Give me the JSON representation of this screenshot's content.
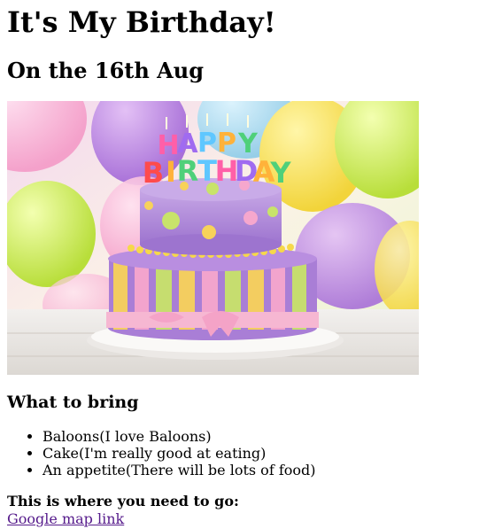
{
  "page": {
    "title": "It's My Birthday!",
    "subtitle": "On the 16th Aug",
    "image": {
      "alt": "Happy Birthday cake with balloons",
      "candle_text": "HAPPY BIRTHDAY"
    },
    "bring": {
      "heading": "What to bring",
      "items": [
        "Baloons(I love Baloons)",
        "Cake(I'm really good at eating)",
        "An appetite(There will be lots of food)"
      ]
    },
    "location": {
      "heading": "This is where you need to go:",
      "link_label": "Google map link"
    }
  }
}
